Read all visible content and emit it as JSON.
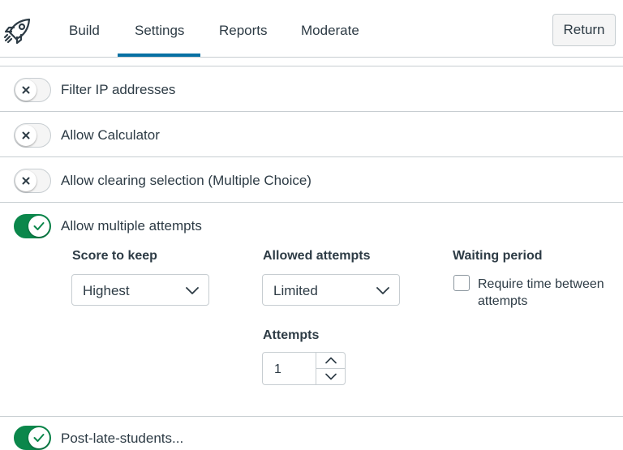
{
  "nav": {
    "logo_icon": "rocket-icon",
    "tabs": [
      {
        "label": "Build"
      },
      {
        "label": "Settings",
        "active": true
      },
      {
        "label": "Reports"
      },
      {
        "label": "Moderate"
      }
    ],
    "return_label": "Return"
  },
  "settings": [
    {
      "label": "Filter IP addresses",
      "enabled": false
    },
    {
      "label": "Allow Calculator",
      "enabled": false
    },
    {
      "label": "Allow clearing selection (Multiple Choice)",
      "enabled": false
    },
    {
      "label": "Allow multiple attempts",
      "enabled": true
    },
    {
      "label": "Post-late-students...",
      "enabled": true
    }
  ],
  "attempts": {
    "score_to_keep": {
      "label": "Score to keep",
      "value": "Highest"
    },
    "allowed_attempts": {
      "label": "Allowed attempts",
      "value": "Limited"
    },
    "waiting_period": {
      "label": "Waiting period",
      "checkbox_label": "Require time between attempts",
      "checked": false
    },
    "attempts_count": {
      "label": "Attempts",
      "value": "1"
    }
  },
  "colors": {
    "accent": "#0770a3",
    "toggle_on": "#0b874b",
    "text": "#2d3b45",
    "border": "#c7cdd1"
  }
}
